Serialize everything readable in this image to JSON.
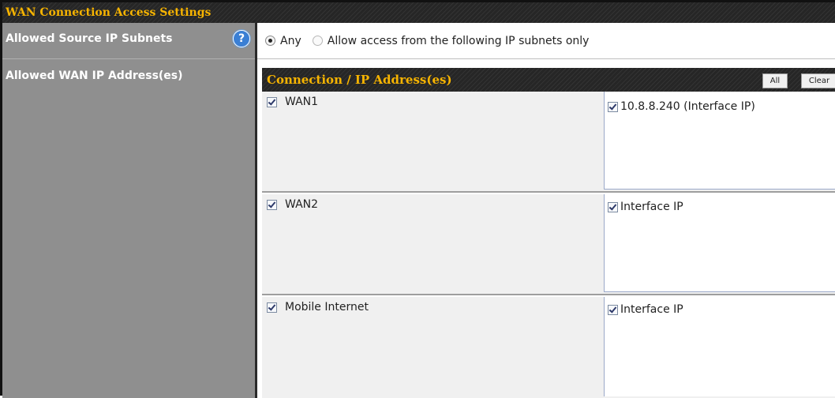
{
  "section_title": "WAN Connection Access Settings",
  "labels": {
    "source_subnets": "Allowed Source IP Subnets",
    "wan_ip_addresses": "Allowed WAN IP Address(es)"
  },
  "help_icon_glyph": "?",
  "source_options": {
    "any_label": "Any",
    "subnets_label": "Allow access from the following IP subnets only",
    "selected": "Any"
  },
  "table": {
    "header": "Connection / IP Address(es)",
    "all_button": "All",
    "clear_button": "Clear",
    "rows": [
      {
        "connection": "WAN1",
        "connection_checked": true,
        "ip": "10.8.8.240 (Interface IP)",
        "ip_checked": true
      },
      {
        "connection": "WAN2",
        "connection_checked": true,
        "ip": "Interface IP",
        "ip_checked": true
      },
      {
        "connection": "Mobile Internet",
        "connection_checked": true,
        "ip": "Interface IP",
        "ip_checked": true
      }
    ]
  },
  "colors": {
    "header_text": "#f7b400",
    "header_background": "#262626",
    "label_background": "#8f8f8f",
    "row_background": "#f0f0f0"
  }
}
